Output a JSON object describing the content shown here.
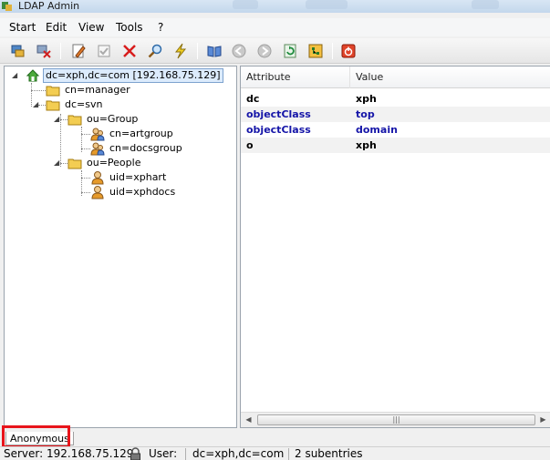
{
  "window": {
    "title": "LDAP Admin"
  },
  "menu": {
    "items": [
      "Start",
      "Edit",
      "View",
      "Tools",
      "?"
    ]
  },
  "toolbar": {
    "buttons": [
      {
        "name": "connect-icon"
      },
      {
        "name": "disconnect-icon"
      },
      {
        "name": "edit-entry-icon"
      },
      {
        "name": "properties-icon"
      },
      {
        "name": "delete-icon"
      },
      {
        "name": "search-icon"
      },
      {
        "name": "lightning-icon"
      },
      {
        "name": "schema-book-icon"
      },
      {
        "name": "back-icon"
      },
      {
        "name": "forward-icon"
      },
      {
        "name": "refresh-icon"
      },
      {
        "name": "tree-view-icon"
      },
      {
        "name": "exit-icon"
      }
    ]
  },
  "tree": {
    "root": "dc=xph,dc=com [192.168.75.129]",
    "manager": "cn=manager",
    "svn": "dc=svn",
    "group": "ou=Group",
    "artgroup": "cn=artgroup",
    "docsgroup": "cn=docsgroup",
    "people": "ou=People",
    "xphart": "uid=xphart",
    "xphdocs": "uid=xphdocs"
  },
  "attributes": {
    "headers": {
      "attribute": "Attribute",
      "value": "Value"
    },
    "rows": [
      {
        "attribute": "dc",
        "value": "xph"
      },
      {
        "attribute": "objectClass",
        "value": "top"
      },
      {
        "attribute": "objectClass",
        "value": "domain"
      },
      {
        "attribute": "o",
        "value": "xph"
      }
    ]
  },
  "tabs": {
    "active": "Anonymous"
  },
  "status": {
    "server": "Server: 192.168.75.129",
    "user": "User:",
    "base": "dc=xph,dc=com",
    "subentries": "2 subentries"
  },
  "colors": {
    "attr_blue": "#1515a8",
    "highlight_red": "#e8141b",
    "folder_yellow": "#f3cd52"
  }
}
